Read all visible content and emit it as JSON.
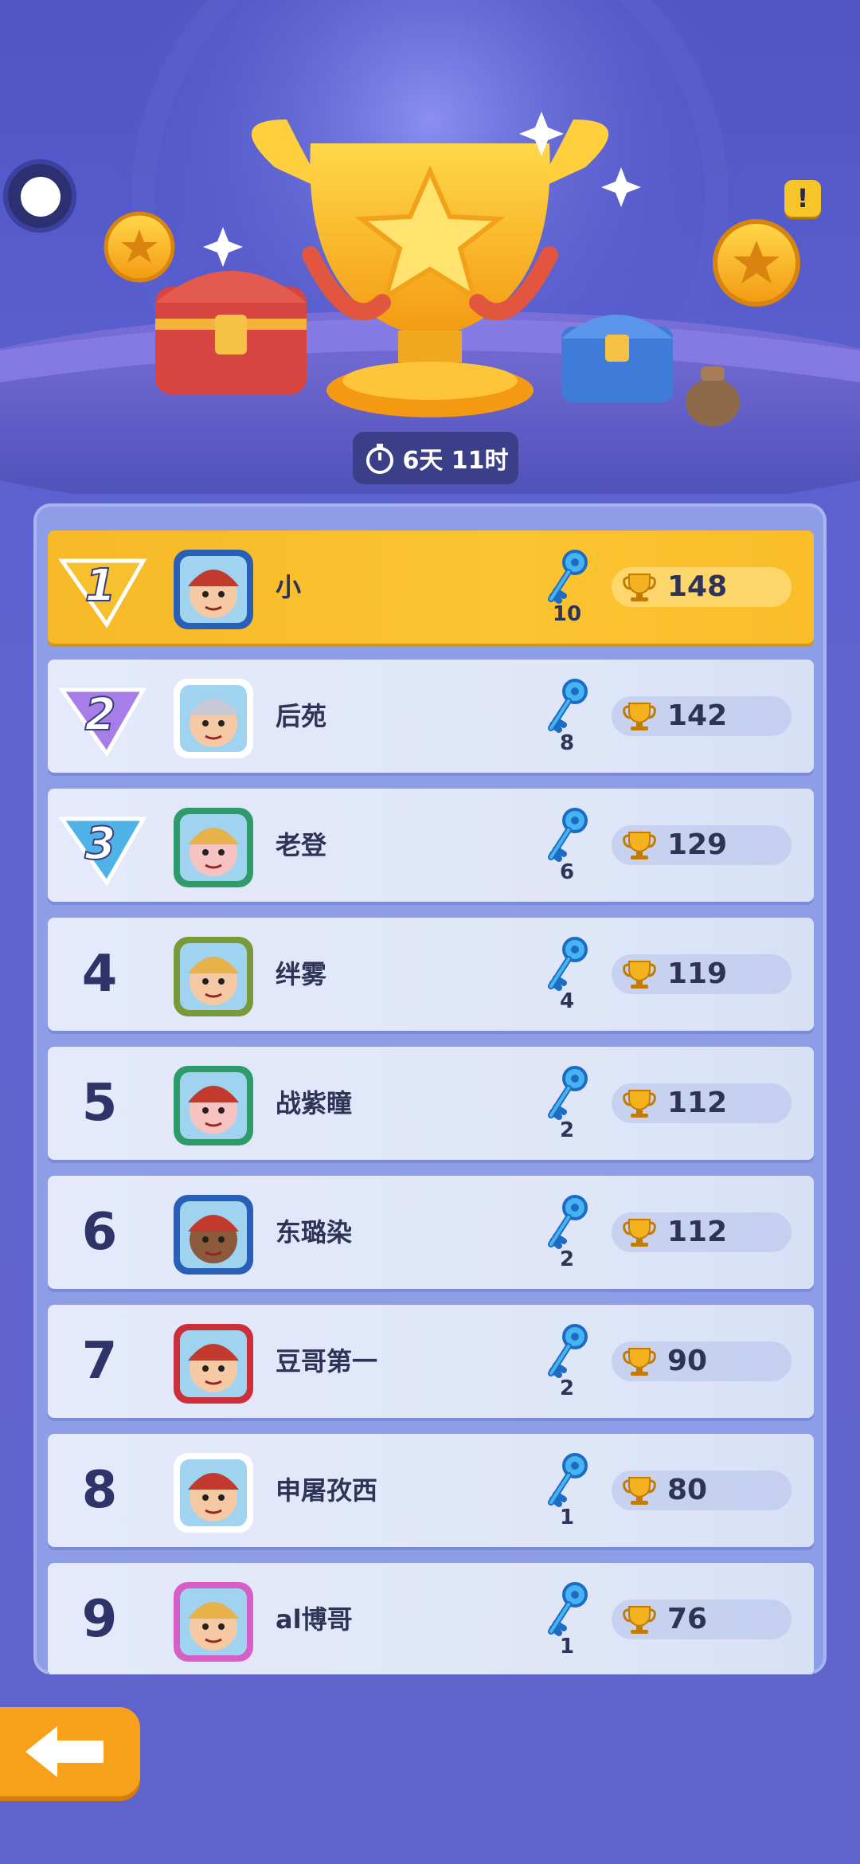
{
  "timer": {
    "text": "6天 11时"
  },
  "header": {
    "alert_glyph": "!"
  },
  "players": [
    {
      "rank": "1",
      "name": "小",
      "keys": "10",
      "score": "148",
      "avatar": "boy-red-cap-blue-frame"
    },
    {
      "rank": "2",
      "name": "后苑",
      "keys": "8",
      "score": "142",
      "avatar": "masked-ninja"
    },
    {
      "rank": "3",
      "name": "老登",
      "keys": "6",
      "score": "129",
      "avatar": "girl-pig-hat"
    },
    {
      "rank": "4",
      "name": "绊雾",
      "keys": "4",
      "score": "119",
      "avatar": "blonde-girl-flower-frame"
    },
    {
      "rank": "5",
      "name": "战紫瞳",
      "keys": "2",
      "score": "112",
      "avatar": "pig-green-frame"
    },
    {
      "rank": "6",
      "name": "东璐染",
      "keys": "2",
      "score": "112",
      "avatar": "boy-glasses-blue-frame"
    },
    {
      "rank": "7",
      "name": "豆哥第一",
      "keys": "2",
      "score": "90",
      "avatar": "boy-red-cap-red-frame"
    },
    {
      "rank": "8",
      "name": "申屠孜西",
      "keys": "1",
      "score": "80",
      "avatar": "boy-red-cap"
    },
    {
      "rank": "9",
      "name": "al博哥",
      "keys": "1",
      "score": "76",
      "avatar": "girl-pink-frame"
    }
  ],
  "colors": {
    "gold_row": "#fcc431",
    "row": "#e4eafb",
    "board": "#8e9de8",
    "back_button": "#f7a11a"
  },
  "icons": {
    "key": "blue-key-icon",
    "trophy": "trophy-icon",
    "timer": "stopwatch-icon",
    "back": "back-arrow-icon"
  }
}
